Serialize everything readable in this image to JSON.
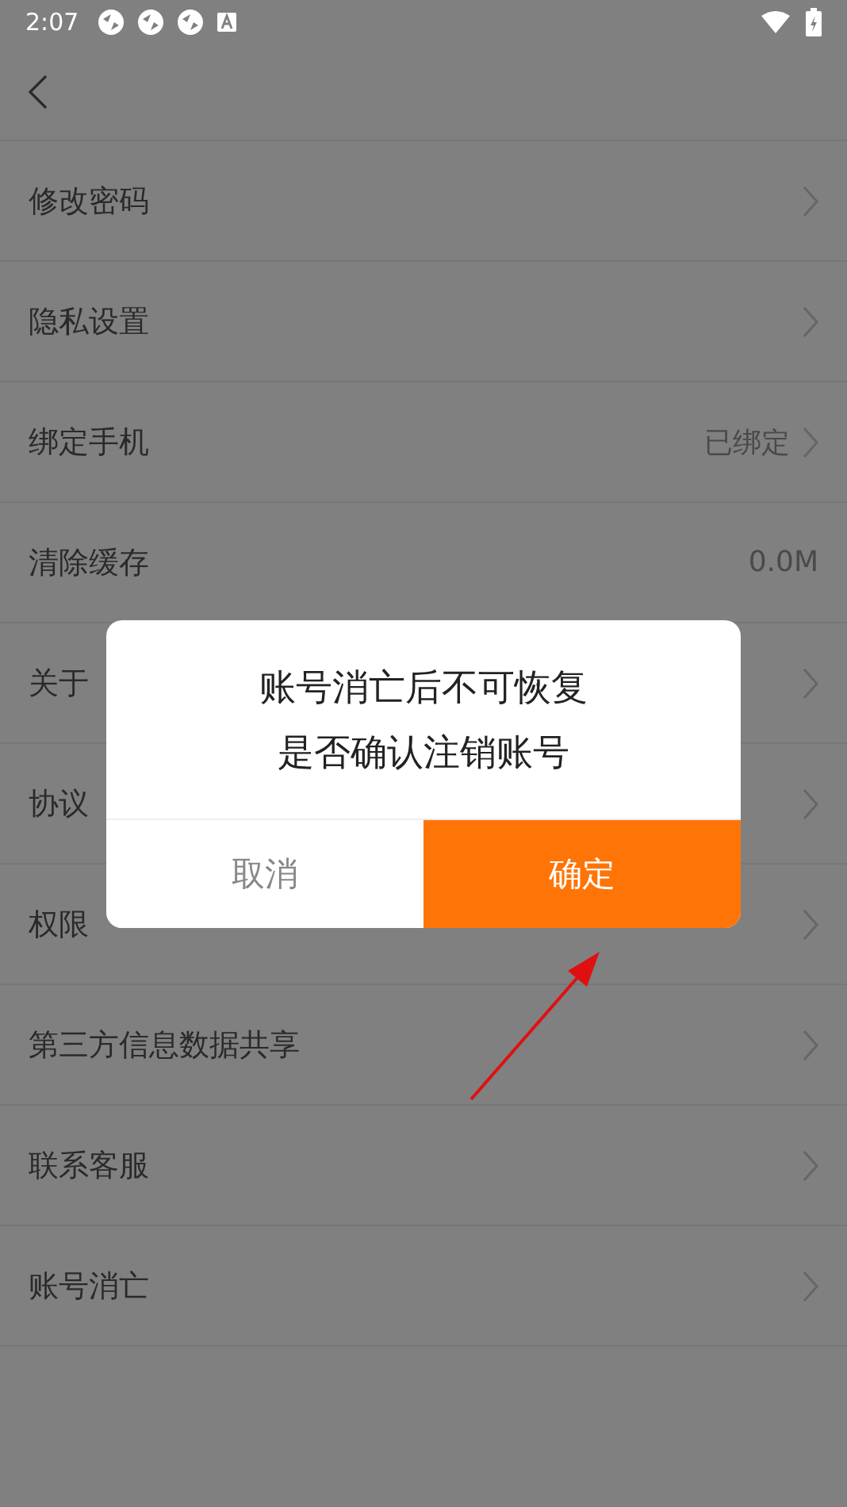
{
  "status_bar": {
    "time": "2:07"
  },
  "rows": [
    {
      "label": "修改密码",
      "chevron": true
    },
    {
      "label": "隐私设置",
      "chevron": true
    },
    {
      "label": "绑定手机",
      "value": "已绑定",
      "chevron": true
    },
    {
      "label": "清除缓存",
      "value": "0.0M",
      "chevron": false
    },
    {
      "label": "关于",
      "chevron": true
    },
    {
      "label": "协议",
      "chevron": true
    },
    {
      "label": "权限",
      "chevron": true
    },
    {
      "label": "第三方信息数据共享",
      "chevron": true
    },
    {
      "label": "联系客服",
      "chevron": true
    },
    {
      "label": "账号消亡",
      "chevron": true
    }
  ],
  "dialog": {
    "message": [
      "账号消亡后不可恢复",
      "是否确认注销账号"
    ],
    "buttons": [
      {
        "label": "取消",
        "kind": "cancel"
      },
      {
        "label": "确定",
        "kind": "confirm"
      }
    ]
  }
}
